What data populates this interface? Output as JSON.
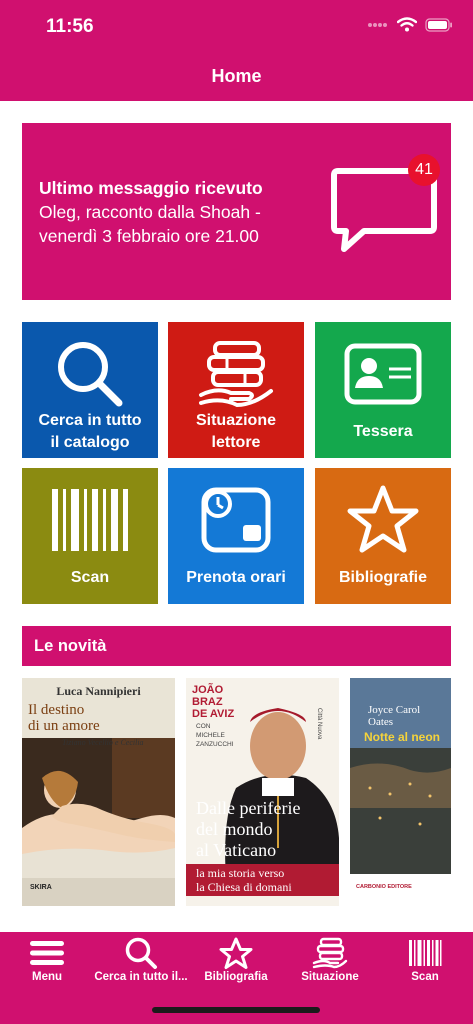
{
  "status_bar": {
    "time": "11:56"
  },
  "header": {
    "title": "Home"
  },
  "banner": {
    "title": "Ultimo messaggio ricevuto",
    "line1": "Oleg, racconto dalla Shoah -",
    "line2": "venerdì 3 febbraio ore 21.00",
    "badge_count": "41",
    "icon": "chat-bubble-icon"
  },
  "tiles": [
    {
      "label1": "Cerca in tutto",
      "label2": "il catalogo",
      "color": "#0a58ad",
      "icon": "search-icon"
    },
    {
      "label1": "Situazione",
      "label2": "lettore",
      "color": "#cf1b14",
      "icon": "books-hand-icon"
    },
    {
      "label1": "Tessera",
      "label2": "",
      "color": "#14a84d",
      "icon": "id-card-icon"
    },
    {
      "label1": "Scan",
      "label2": "",
      "color": "#8b8b11",
      "icon": "barcode-icon"
    },
    {
      "label1": "Prenota orari",
      "label2": "",
      "color": "#1479d6",
      "icon": "calendar-clock-icon"
    },
    {
      "label1": "Bibliografie",
      "label2": "",
      "color": "#d86a12",
      "icon": "star-icon"
    }
  ],
  "news": {
    "title": "Le novità",
    "books": [
      {
        "author": "Luca Nannipieri",
        "title1": "Il destino",
        "title2": "di un amore",
        "subtitle": "Tiziano Vecellio e Cecilia",
        "publisher": "SKIRA"
      },
      {
        "author1": "JOÃO",
        "author2": "BRAZ",
        "author3": "DE AVIZ",
        "with": "CON",
        "coauthor1": "MICHELE",
        "coauthor2": "ZANZUCCHI",
        "title1": "Dalle periferie",
        "title2": "del mondo",
        "title3": "al Vaticano",
        "subtitle1": "la mia storia verso",
        "subtitle2": "la Chiesa di domani",
        "publisher": "Città Nuova"
      },
      {
        "author1": "Joyce Carol",
        "author2": "Oates",
        "title": "Notte al neon",
        "publisher": "CARBONIO EDITORE"
      }
    ]
  },
  "tabbar": [
    {
      "label": "Menu",
      "icon": "hamburger-menu-icon"
    },
    {
      "label": "Cerca in tutto il...",
      "icon": "search-icon"
    },
    {
      "label": "Bibliografia",
      "icon": "star-icon"
    },
    {
      "label": "Situazione",
      "icon": "books-hand-icon"
    },
    {
      "label": "Scan",
      "icon": "barcode-icon"
    }
  ],
  "colors": {
    "brand": "#d0106f",
    "badge": "#e8112d"
  }
}
